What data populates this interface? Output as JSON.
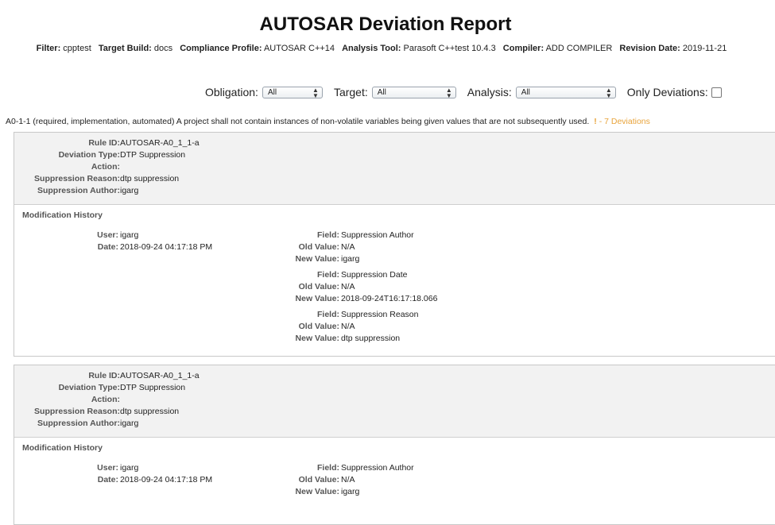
{
  "page": {
    "title": "AUTOSAR Deviation Report"
  },
  "meta": [
    {
      "label": "Filter:",
      "value": "cpptest"
    },
    {
      "label": "Target Build:",
      "value": "docs"
    },
    {
      "label": "Compliance Profile:",
      "value": "AUTOSAR C++14"
    },
    {
      "label": "Analysis Tool:",
      "value": "Parasoft C++test 10.4.3"
    },
    {
      "label": "Compiler:",
      "value": "ADD COMPILER"
    },
    {
      "label": "Revision Date:",
      "value": "2019-11-21"
    }
  ],
  "filters": {
    "obligation": {
      "label": "Obligation:",
      "selected": "All"
    },
    "target": {
      "label": "Target:",
      "selected": "All"
    },
    "analysis": {
      "label": "Analysis:",
      "selected": "All"
    },
    "only_deviations": {
      "label": "Only Deviations:",
      "checked": false
    }
  },
  "rule": {
    "text": "A0-1-1 (required, implementation, automated) A project shall not contain instances of non-volatile variables being given values that are not subsequently used.",
    "bang": "!",
    "deviations": "- 7 Deviations"
  },
  "labels": {
    "rule_id": "Rule ID:",
    "deviation_type": "Deviation Type:",
    "action": "Action:",
    "suppression_reason": "Suppression Reason:",
    "suppression_author": "Suppression Author:",
    "modification_history": "Modification History",
    "user": "User:",
    "date": "Date:",
    "field": "Field:",
    "old_value": "Old Value:",
    "new_value": "New Value:"
  },
  "deviations": [
    {
      "rule_id": "AUTOSAR-A0_1_1-a",
      "deviation_type": "DTP Suppression",
      "action": "",
      "suppression_reason": "dtp suppression",
      "suppression_author": "igarg",
      "history": {
        "user": "igarg",
        "date": "2018-09-24 04:17:18 PM",
        "changes": [
          {
            "field": "Suppression Author",
            "old_value": "N/A",
            "new_value": "igarg"
          },
          {
            "field": "Suppression Date",
            "old_value": "N/A",
            "new_value": "2018-09-24T16:17:18.066"
          },
          {
            "field": "Suppression Reason",
            "old_value": "N/A",
            "new_value": "dtp suppression"
          }
        ]
      }
    },
    {
      "rule_id": "AUTOSAR-A0_1_1-a",
      "deviation_type": "DTP Suppression",
      "action": "",
      "suppression_reason": "dtp suppression",
      "suppression_author": "igarg",
      "history": {
        "user": "igarg",
        "date": "2018-09-24 04:17:18 PM",
        "changes": [
          {
            "field": "Suppression Author",
            "old_value": "N/A",
            "new_value": "igarg"
          }
        ]
      }
    }
  ]
}
